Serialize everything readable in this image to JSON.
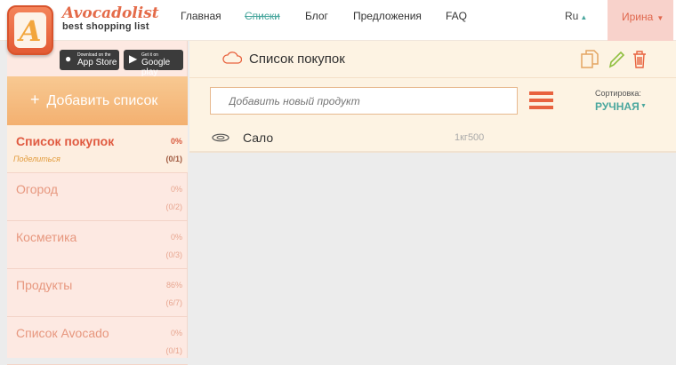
{
  "brand": {
    "title": "Avocadolist",
    "subtitle": "best shopping list",
    "logo_letter": "A"
  },
  "nav": [
    {
      "label": "Главная"
    },
    {
      "label": "Списки"
    },
    {
      "label": "Блог"
    },
    {
      "label": "Предложения"
    },
    {
      "label": "FAQ"
    }
  ],
  "language": "Ru",
  "user": {
    "name": "Ирина"
  },
  "stores": {
    "appstore": {
      "small": "Download on the",
      "big": "App Store"
    },
    "googleplay": {
      "small": "Get it on",
      "big": "Google play"
    }
  },
  "sidebar": {
    "add_list_label": "Добавить список",
    "lists": [
      {
        "name": "Список покупок",
        "percent": "0%",
        "count": "(0/1)",
        "share": "Поделиться"
      },
      {
        "name": "Огород",
        "percent": "0%",
        "count": "(0/2)"
      },
      {
        "name": "Косметика",
        "percent": "0%",
        "count": "(0/3)"
      },
      {
        "name": "Продукты",
        "percent": "86%",
        "count": "(6/7)"
      },
      {
        "name": "Список Avocado",
        "percent": "0%",
        "count": "(0/1)"
      }
    ]
  },
  "main": {
    "title": "Список покупок",
    "new_product_placeholder": "Добавить новый продукт",
    "sort_label": "Сортировка:",
    "sort_value": "РУЧНАЯ",
    "products": [
      {
        "name": "Сало",
        "quantity": "1кг500"
      }
    ]
  },
  "colors": {
    "accent": "#e8633f",
    "teal": "#4aa79e",
    "sidebar_bg": "#fde9e2"
  }
}
